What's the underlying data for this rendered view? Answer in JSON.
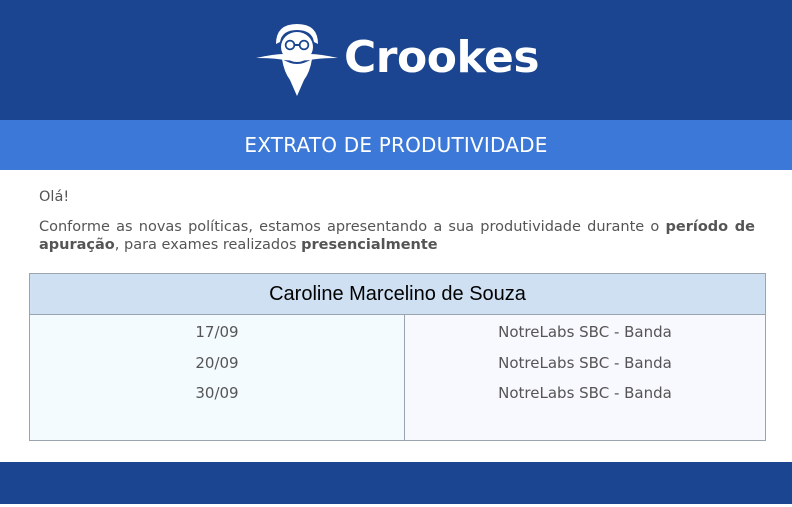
{
  "header": {
    "brand_name": "Crookes",
    "logo_icon": "bearded-man-with-glasses-mascot-icon",
    "background_color": "#1b4590"
  },
  "banner": {
    "title": "EXTRATO DE PRODUTIVIDADE",
    "background_color": "#3b78d8"
  },
  "message": {
    "greeting": "Olá!",
    "intro_part1": "Conforme as novas políticas, estamos apresentando a sua produtividade durante o ",
    "intro_bold1": "período de apuração",
    "intro_part2": ", para exames realizados ",
    "intro_bold2": "presencialmente"
  },
  "card": {
    "name": "Caroline Marcelino de Souza",
    "title_background": "#cfe0f3",
    "rows": [
      {
        "date": "17/09",
        "location": "NotreLabs SBC - Banda"
      },
      {
        "date": "20/09",
        "location": "NotreLabs SBC - Banda"
      },
      {
        "date": "30/09",
        "location": "NotreLabs SBC - Banda"
      }
    ]
  },
  "footer": {
    "background_color": "#1b4590"
  }
}
